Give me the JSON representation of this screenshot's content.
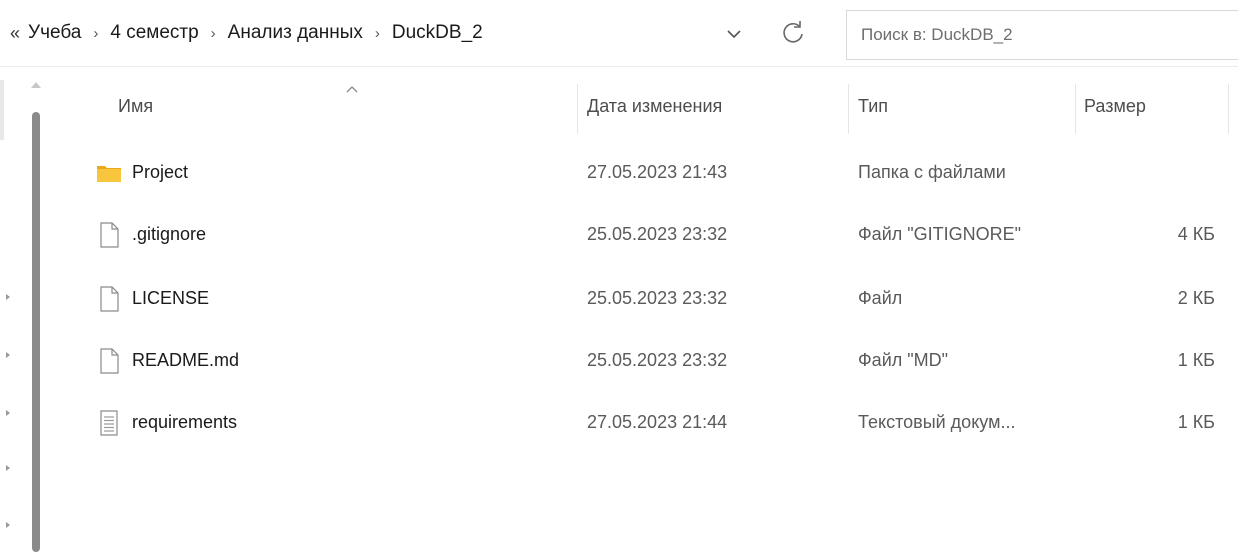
{
  "breadcrumb": {
    "overflow": "«",
    "items": [
      "Учеба",
      "4 семестр",
      "Анализ данных",
      "DuckDB_2"
    ],
    "separator": "›"
  },
  "search": {
    "placeholder": "Поиск в: DuckDB_2"
  },
  "columns": {
    "name": "Имя",
    "date": "Дата изменения",
    "type": "Тип",
    "size": "Размер"
  },
  "files": [
    {
      "name": "Project",
      "date": "27.05.2023 21:43",
      "type": "Папка с файлами",
      "size": "",
      "icon": "folder-icon"
    },
    {
      "name": ".gitignore",
      "date": "25.05.2023 23:32",
      "type": "Файл \"GITIGNORE\"",
      "size": "4 КБ",
      "icon": "file-icon"
    },
    {
      "name": "LICENSE",
      "date": "25.05.2023 23:32",
      "type": "Файл",
      "size": "2 КБ",
      "icon": "file-icon"
    },
    {
      "name": "README.md",
      "date": "25.05.2023 23:32",
      "type": "Файл \"MD\"",
      "size": "1 КБ",
      "icon": "file-icon"
    },
    {
      "name": "requirements",
      "date": "27.05.2023 21:44",
      "type": "Текстовый докум...",
      "size": "1 КБ",
      "icon": "text-document-icon"
    }
  ],
  "colors": {
    "folder": "#f8c63d",
    "folder_dark": "#e8a817",
    "scroll_thumb": "#8a8a8a"
  }
}
